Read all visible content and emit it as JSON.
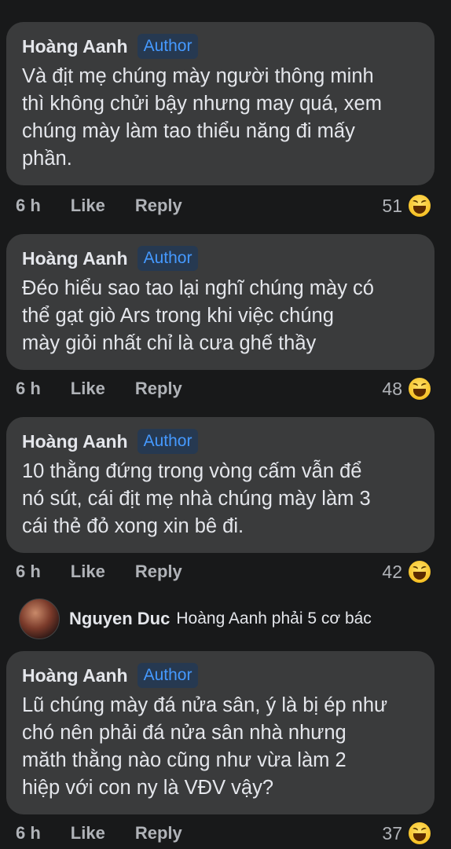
{
  "comments": [
    {
      "author": "Hoàng Aanh",
      "badge": "Author",
      "text": "Và địt mẹ chúng mày người thông minh\nthì không chửi bậy nhưng may quá, xem\nchúng mày làm tao thiểu năng đi mấy\nphần.",
      "time": "6 h",
      "like": "Like",
      "reply": "Reply",
      "reactions": "51",
      "reaction_icon": "laughing-emoji-icon"
    },
    {
      "author": "Hoàng Aanh",
      "badge": "Author",
      "text": "Đéo hiểu sao tao lại nghĩ chúng mày có\nthể gạt giò Ars trong khi việc chúng\nmày giỏi nhất chỉ là cưa ghế thầy",
      "time": "6 h",
      "like": "Like",
      "reply": "Reply",
      "reactions": "48",
      "reaction_icon": "laughing-emoji-icon"
    },
    {
      "author": "Hoàng Aanh",
      "badge": "Author",
      "text": "10 thằng đứng trong vòng cấm vẫn để\nnó sút, cái địt mẹ nhà chúng mày làm 3\ncái thẻ đỏ xong xin bê đi.",
      "time": "6 h",
      "like": "Like",
      "reply": "Reply",
      "reactions": "42",
      "reaction_icon": "laughing-emoji-icon"
    },
    {
      "author": "Hoàng Aanh",
      "badge": "Author",
      "text": "Lũ chúng mày đá nửa sân, ý là bị ép như\nchó nên phải đá nửa sân nhà nhưng\nmăth thằng nào cũng như vừa làm 2\nhiệp với con ny là VĐV vậy?",
      "time": "6 h",
      "like": "Like",
      "reply": "Reply",
      "reactions": "37",
      "reaction_icon": "laughing-emoji-icon"
    }
  ],
  "reply_preview": {
    "name": "Nguyen Duc",
    "text": "Hoàng Aanh phải 5 cơ bác"
  }
}
